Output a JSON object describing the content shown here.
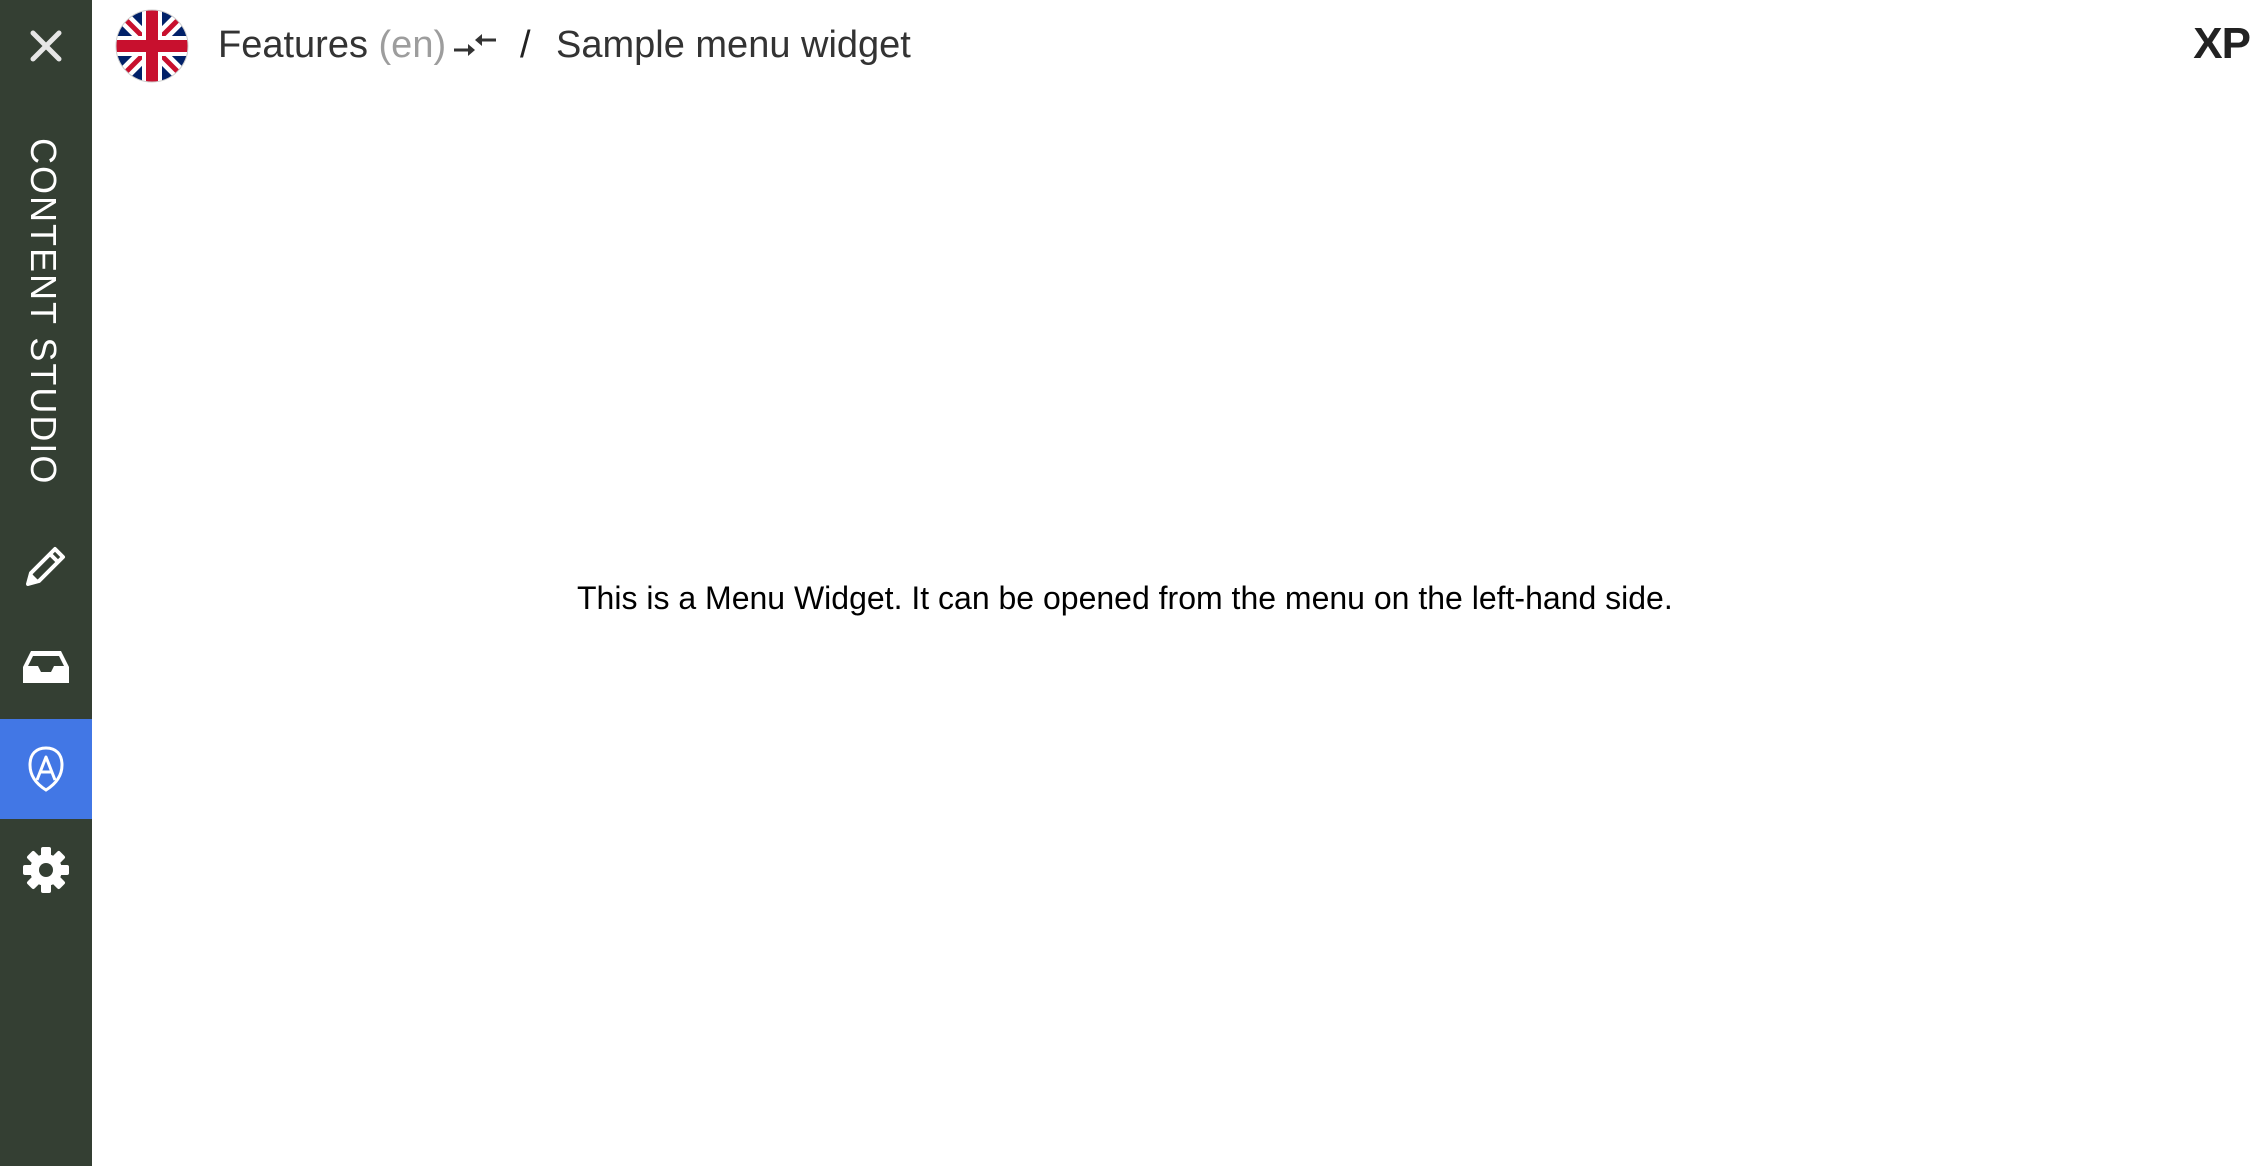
{
  "sidebar": {
    "app_name": "CONTENT STUDIO",
    "items": [
      {
        "icon": "pencil-icon",
        "active": false
      },
      {
        "icon": "inbox-icon",
        "active": false
      },
      {
        "icon": "widget-shield-icon",
        "active": true
      },
      {
        "icon": "gear-icon",
        "active": false
      }
    ]
  },
  "header": {
    "project_name": "Features",
    "language": "(en)",
    "separator": "/",
    "page_name": "Sample menu widget",
    "logo": "XP"
  },
  "main": {
    "message": "This is a Menu Widget. It can be opened from the menu on the left-hand side."
  },
  "colors": {
    "sidebar_bg": "#343f33",
    "active_item": "#4277e5",
    "language_text": "#9d9d9d"
  }
}
